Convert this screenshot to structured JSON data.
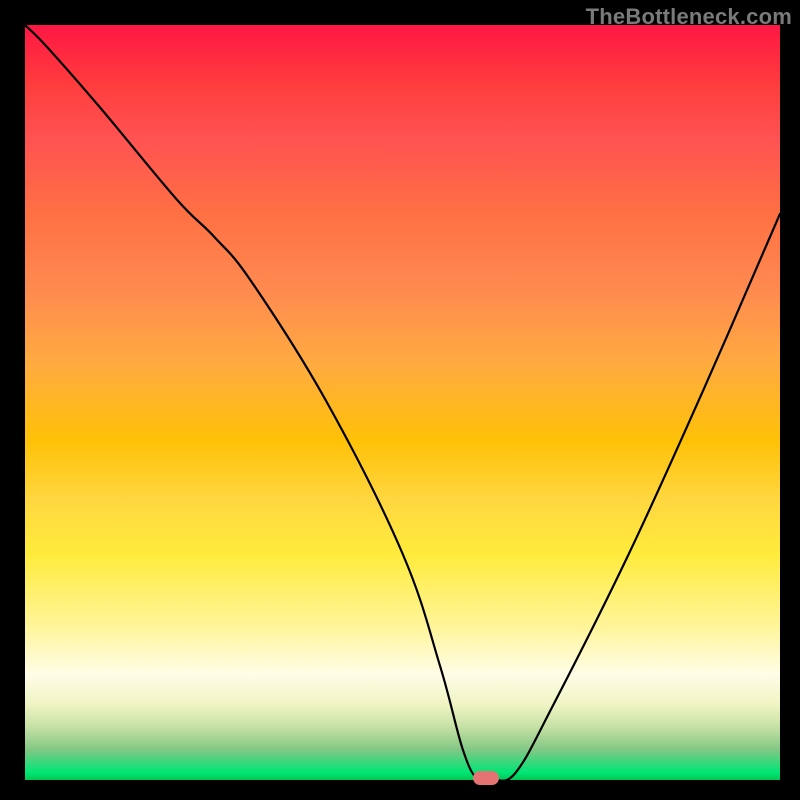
{
  "watermark": "TheBottleneck.com",
  "chart_data": {
    "type": "line",
    "title": "",
    "xlabel": "",
    "ylabel": "",
    "xlim": [
      0,
      100
    ],
    "ylim": [
      0,
      100
    ],
    "grid": false,
    "series": [
      {
        "name": "curve",
        "x": [
          0,
          3,
          10,
          20,
          25,
          30,
          40,
          50,
          55,
          58,
          60,
          62,
          65,
          70,
          80,
          90,
          100
        ],
        "y": [
          100,
          97,
          89,
          77,
          72,
          66,
          50,
          30,
          15,
          4,
          0,
          0,
          1,
          10,
          30,
          52,
          75
        ]
      }
    ],
    "marker": {
      "x": 61,
      "y": 0,
      "color": "#e57373"
    },
    "background_gradient": {
      "stops": [
        {
          "pos": 0.0,
          "color": "#ff1744"
        },
        {
          "pos": 0.5,
          "color": "#ffc107"
        },
        {
          "pos": 0.8,
          "color": "#fff59d"
        },
        {
          "pos": 0.96,
          "color": "#81c784"
        },
        {
          "pos": 1.0,
          "color": "#00c853"
        }
      ]
    }
  }
}
